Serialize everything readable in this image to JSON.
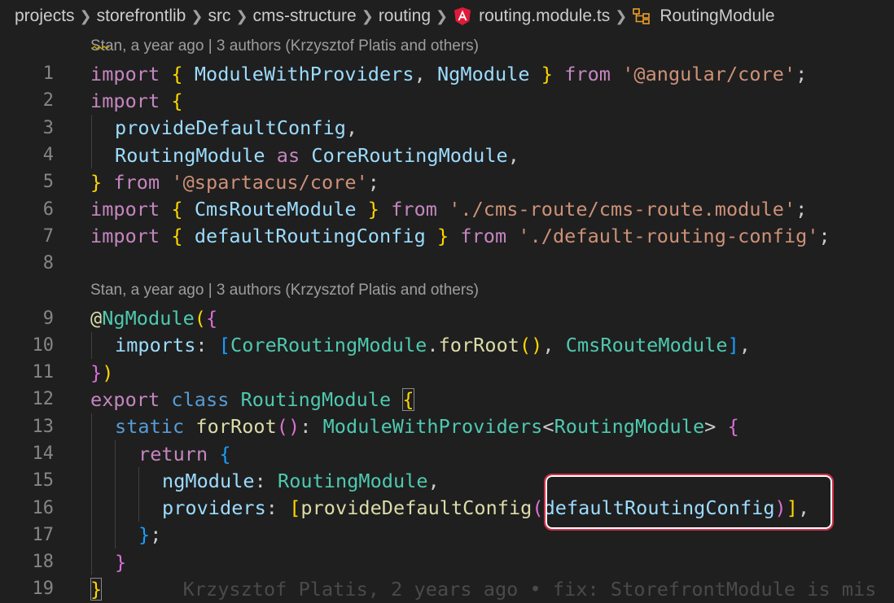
{
  "breadcrumb": {
    "items": [
      "projects",
      "storefrontlib",
      "src",
      "cms-structure",
      "routing"
    ],
    "file": "routing.module.ts",
    "symbol": "RoutingModule"
  },
  "codelens": {
    "top": "Stan, a year ago | 3 authors (Krzysztof Platis and others)",
    "middle": "Stan, a year ago | 3 authors (Krzysztof Platis and others)"
  },
  "lines": [
    "1",
    "2",
    "3",
    "4",
    "5",
    "6",
    "7",
    "8",
    "9",
    "10",
    "11",
    "12",
    "13",
    "14",
    "15",
    "16",
    "17",
    "18",
    "19"
  ],
  "code": {
    "l1": [
      "import",
      "{",
      "ModuleWithProviders",
      ",",
      "NgModule",
      "}",
      "from",
      "'@angular/core'",
      ";"
    ],
    "l2": [
      "import",
      "{"
    ],
    "l3": [
      "provideDefaultConfig",
      ","
    ],
    "l4": [
      "RoutingModule",
      "as",
      "CoreRoutingModule",
      ","
    ],
    "l5": [
      "}",
      "from",
      "'@spartacus/core'",
      ";"
    ],
    "l6": [
      "import",
      "{",
      "CmsRouteModule",
      "}",
      "from",
      "'./cms-route/cms-route.module'",
      ";"
    ],
    "l7": [
      "import",
      "{",
      "defaultRoutingConfig",
      "}",
      "from",
      "'./default-routing-config'",
      ";"
    ],
    "l9": [
      "@",
      "NgModule",
      "(",
      "{"
    ],
    "l10": [
      "imports",
      ":",
      "[",
      "CoreRoutingModule",
      ".",
      "forRoot",
      "(",
      ")",
      ",",
      "CmsRouteModule",
      "]",
      ","
    ],
    "l11": [
      "}",
      ")"
    ],
    "l12": [
      "export",
      "class",
      "RoutingModule",
      "{"
    ],
    "l13": [
      "static",
      "forRoot",
      "(",
      ")",
      ":",
      "ModuleWithProviders",
      "<",
      "RoutingModule",
      ">",
      "{"
    ],
    "l14": [
      "return",
      "{"
    ],
    "l15": [
      "ngModule",
      ":",
      "RoutingModule",
      ","
    ],
    "l16": [
      "providers",
      ":",
      "[",
      "provideDefaultConfig",
      "(",
      "defaultRoutingConfig",
      ")",
      "]",
      ","
    ],
    "l17": [
      "}",
      ";"
    ],
    "l18": [
      "}"
    ],
    "l19": [
      "}"
    ]
  },
  "blame_inline": "Krzysztof Platis, 2 years ago • fix: StorefrontModule is mis",
  "colors": {
    "background": "#1f1f1f",
    "keyword": "#c586c0",
    "storage": "#569cd6",
    "variable": "#9cdcfe",
    "type": "#4ec9b0",
    "function": "#dcdcaa",
    "string": "#ce9178",
    "highlight": "#d0304a"
  },
  "icons": {
    "file": "angular-icon",
    "symbol": "class-symbol-icon"
  }
}
